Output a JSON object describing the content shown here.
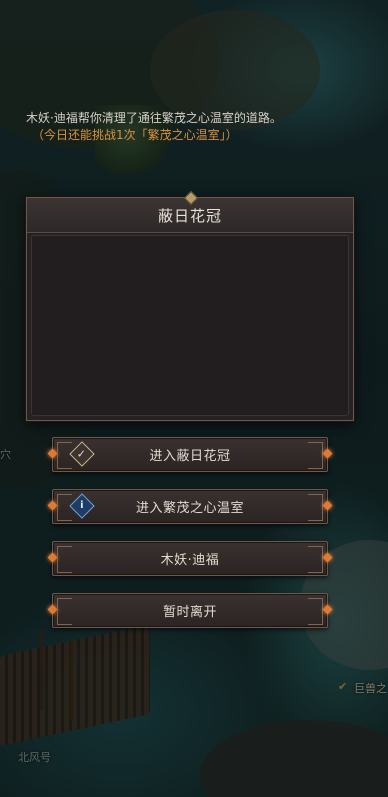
{
  "map": {
    "labels": {
      "ship_name": "北风号",
      "left_edge": "穴",
      "right_edge": "巨兽之"
    }
  },
  "dialog": {
    "title": "蔽日花冠",
    "message": "木妖·迪福帮你清理了通往繁茂之心温室的道路。",
    "note": "（今日还能挑战1次「繁茂之心温室」）"
  },
  "options": [
    {
      "label": "进入蔽日花冠",
      "icon": "checkmark-diamond-icon"
    },
    {
      "label": "进入繁茂之心温室",
      "icon": "info-diamond-icon"
    },
    {
      "label": "木妖·迪福",
      "icon": ""
    },
    {
      "label": "暂时离开",
      "icon": ""
    }
  ],
  "colors": {
    "accent_orange": "#d8913f",
    "panel_bg": "#262122",
    "border": "#6e5a48"
  }
}
